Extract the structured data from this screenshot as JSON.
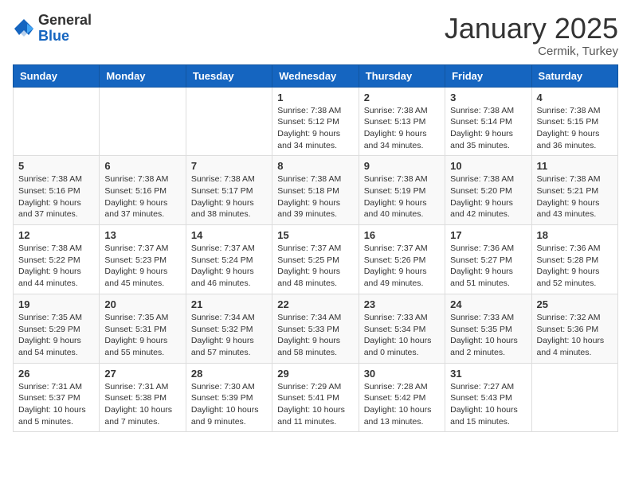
{
  "header": {
    "logo_general": "General",
    "logo_blue": "Blue",
    "month_title": "January 2025",
    "location": "Cermik, Turkey"
  },
  "weekdays": [
    "Sunday",
    "Monday",
    "Tuesday",
    "Wednesday",
    "Thursday",
    "Friday",
    "Saturday"
  ],
  "weeks": [
    [
      {
        "day": "",
        "info": ""
      },
      {
        "day": "",
        "info": ""
      },
      {
        "day": "",
        "info": ""
      },
      {
        "day": "1",
        "info": "Sunrise: 7:38 AM\nSunset: 5:12 PM\nDaylight: 9 hours\nand 34 minutes."
      },
      {
        "day": "2",
        "info": "Sunrise: 7:38 AM\nSunset: 5:13 PM\nDaylight: 9 hours\nand 34 minutes."
      },
      {
        "day": "3",
        "info": "Sunrise: 7:38 AM\nSunset: 5:14 PM\nDaylight: 9 hours\nand 35 minutes."
      },
      {
        "day": "4",
        "info": "Sunrise: 7:38 AM\nSunset: 5:15 PM\nDaylight: 9 hours\nand 36 minutes."
      }
    ],
    [
      {
        "day": "5",
        "info": "Sunrise: 7:38 AM\nSunset: 5:16 PM\nDaylight: 9 hours\nand 37 minutes."
      },
      {
        "day": "6",
        "info": "Sunrise: 7:38 AM\nSunset: 5:16 PM\nDaylight: 9 hours\nand 37 minutes."
      },
      {
        "day": "7",
        "info": "Sunrise: 7:38 AM\nSunset: 5:17 PM\nDaylight: 9 hours\nand 38 minutes."
      },
      {
        "day": "8",
        "info": "Sunrise: 7:38 AM\nSunset: 5:18 PM\nDaylight: 9 hours\nand 39 minutes."
      },
      {
        "day": "9",
        "info": "Sunrise: 7:38 AM\nSunset: 5:19 PM\nDaylight: 9 hours\nand 40 minutes."
      },
      {
        "day": "10",
        "info": "Sunrise: 7:38 AM\nSunset: 5:20 PM\nDaylight: 9 hours\nand 42 minutes."
      },
      {
        "day": "11",
        "info": "Sunrise: 7:38 AM\nSunset: 5:21 PM\nDaylight: 9 hours\nand 43 minutes."
      }
    ],
    [
      {
        "day": "12",
        "info": "Sunrise: 7:38 AM\nSunset: 5:22 PM\nDaylight: 9 hours\nand 44 minutes."
      },
      {
        "day": "13",
        "info": "Sunrise: 7:37 AM\nSunset: 5:23 PM\nDaylight: 9 hours\nand 45 minutes."
      },
      {
        "day": "14",
        "info": "Sunrise: 7:37 AM\nSunset: 5:24 PM\nDaylight: 9 hours\nand 46 minutes."
      },
      {
        "day": "15",
        "info": "Sunrise: 7:37 AM\nSunset: 5:25 PM\nDaylight: 9 hours\nand 48 minutes."
      },
      {
        "day": "16",
        "info": "Sunrise: 7:37 AM\nSunset: 5:26 PM\nDaylight: 9 hours\nand 49 minutes."
      },
      {
        "day": "17",
        "info": "Sunrise: 7:36 AM\nSunset: 5:27 PM\nDaylight: 9 hours\nand 51 minutes."
      },
      {
        "day": "18",
        "info": "Sunrise: 7:36 AM\nSunset: 5:28 PM\nDaylight: 9 hours\nand 52 minutes."
      }
    ],
    [
      {
        "day": "19",
        "info": "Sunrise: 7:35 AM\nSunset: 5:29 PM\nDaylight: 9 hours\nand 54 minutes."
      },
      {
        "day": "20",
        "info": "Sunrise: 7:35 AM\nSunset: 5:31 PM\nDaylight: 9 hours\nand 55 minutes."
      },
      {
        "day": "21",
        "info": "Sunrise: 7:34 AM\nSunset: 5:32 PM\nDaylight: 9 hours\nand 57 minutes."
      },
      {
        "day": "22",
        "info": "Sunrise: 7:34 AM\nSunset: 5:33 PM\nDaylight: 9 hours\nand 58 minutes."
      },
      {
        "day": "23",
        "info": "Sunrise: 7:33 AM\nSunset: 5:34 PM\nDaylight: 10 hours\nand 0 minutes."
      },
      {
        "day": "24",
        "info": "Sunrise: 7:33 AM\nSunset: 5:35 PM\nDaylight: 10 hours\nand 2 minutes."
      },
      {
        "day": "25",
        "info": "Sunrise: 7:32 AM\nSunset: 5:36 PM\nDaylight: 10 hours\nand 4 minutes."
      }
    ],
    [
      {
        "day": "26",
        "info": "Sunrise: 7:31 AM\nSunset: 5:37 PM\nDaylight: 10 hours\nand 5 minutes."
      },
      {
        "day": "27",
        "info": "Sunrise: 7:31 AM\nSunset: 5:38 PM\nDaylight: 10 hours\nand 7 minutes."
      },
      {
        "day": "28",
        "info": "Sunrise: 7:30 AM\nSunset: 5:39 PM\nDaylight: 10 hours\nand 9 minutes."
      },
      {
        "day": "29",
        "info": "Sunrise: 7:29 AM\nSunset: 5:41 PM\nDaylight: 10 hours\nand 11 minutes."
      },
      {
        "day": "30",
        "info": "Sunrise: 7:28 AM\nSunset: 5:42 PM\nDaylight: 10 hours\nand 13 minutes."
      },
      {
        "day": "31",
        "info": "Sunrise: 7:27 AM\nSunset: 5:43 PM\nDaylight: 10 hours\nand 15 minutes."
      },
      {
        "day": "",
        "info": ""
      }
    ]
  ]
}
